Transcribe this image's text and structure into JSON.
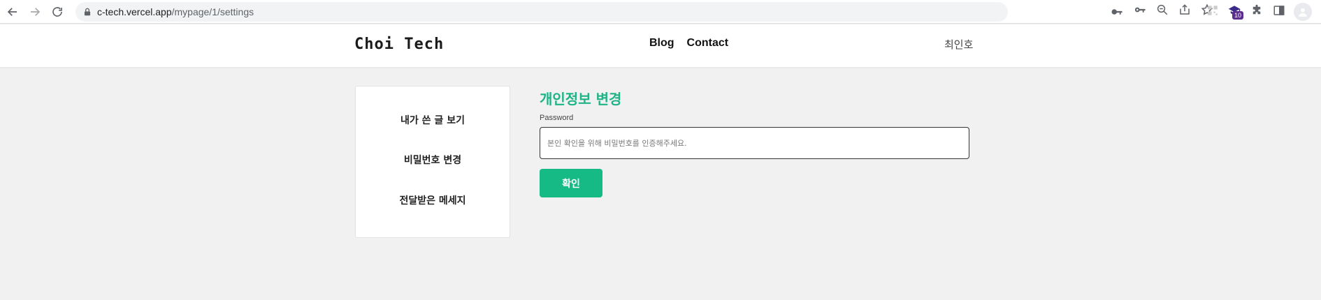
{
  "browser": {
    "url_host": "c-tech.vercel.app",
    "url_path": "/mypage/1/settings",
    "extension_badge": "10"
  },
  "header": {
    "logo": "Choi Tech",
    "nav": [
      {
        "label": "Blog"
      },
      {
        "label": "Contact"
      }
    ],
    "user_name": "최인호"
  },
  "sidebar": {
    "items": [
      {
        "label": "내가 쓴 글 보기"
      },
      {
        "label": "비밀번호 변경"
      },
      {
        "label": "전달받은 메세지"
      }
    ]
  },
  "form": {
    "title": "개인정보 변경",
    "password_label": "Password",
    "password_placeholder": "본인 확인을 위해 비밀번호를 인증해주세요.",
    "password_value": "",
    "submit_label": "확인"
  },
  "colors": {
    "accent": "#16ba85",
    "title": "#1fb385",
    "page_bg": "#f1f1f1"
  },
  "icons": {
    "back": "arrow-left-icon",
    "forward": "arrow-right-icon",
    "reload": "reload-icon",
    "lock": "lock-icon",
    "key": "key-icon",
    "zoom": "zoom-out-icon",
    "share": "share-icon",
    "bookmark": "star-icon",
    "extensions": "puzzle-icon",
    "sidepanel": "side-panel-icon",
    "profile": "profile-avatar-icon"
  }
}
